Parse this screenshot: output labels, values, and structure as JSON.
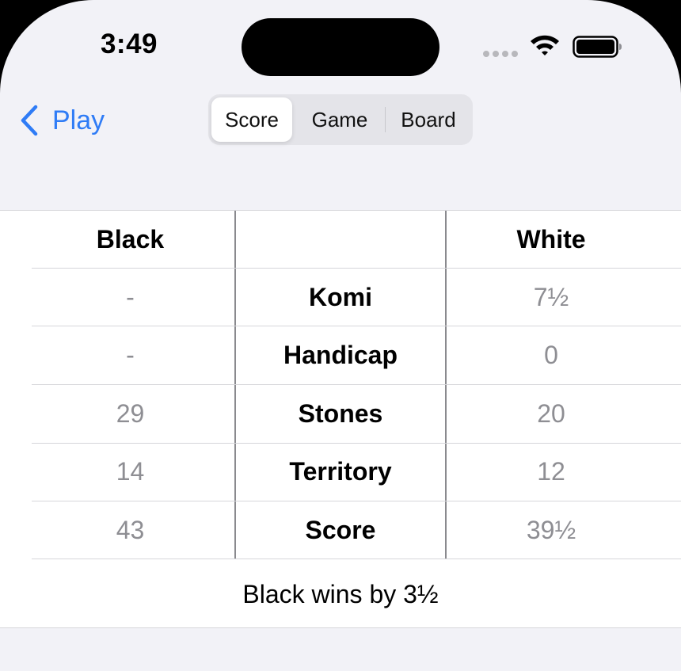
{
  "status_bar": {
    "time": "3:49",
    "icons": [
      "cellular-signal-icon",
      "wifi-icon",
      "battery-icon"
    ]
  },
  "nav": {
    "back_label": "Play",
    "segments": [
      {
        "label": "Score",
        "selected": true
      },
      {
        "label": "Game",
        "selected": false
      },
      {
        "label": "Board",
        "selected": false
      }
    ]
  },
  "score_table": {
    "headers": {
      "left": "Black",
      "middle": "",
      "right": "White"
    },
    "rows": [
      {
        "label": "Komi",
        "black": "-",
        "white": "7½"
      },
      {
        "label": "Handicap",
        "black": "-",
        "white": "0"
      },
      {
        "label": "Stones",
        "black": "29",
        "white": "20"
      },
      {
        "label": "Territory",
        "black": "14",
        "white": "12"
      },
      {
        "label": "Score",
        "black": "43",
        "white": "39½"
      }
    ],
    "result": "Black wins by 3½"
  },
  "colors": {
    "accent": "#2f7cf6",
    "background": "#f2f2f7",
    "value_text": "#8e8e93"
  }
}
